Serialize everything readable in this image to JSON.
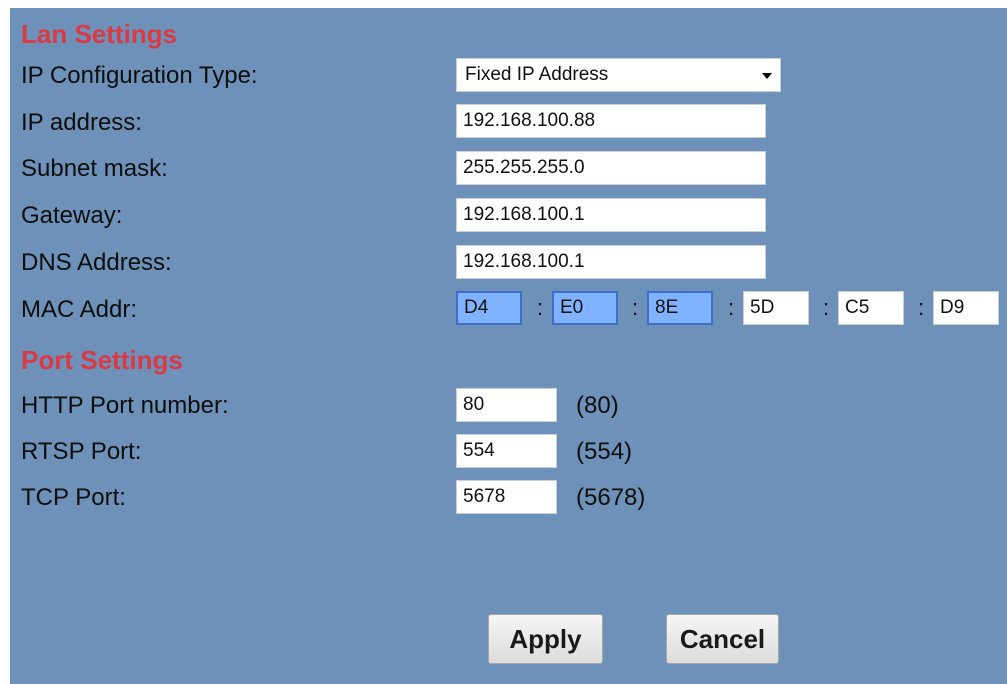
{
  "lan": {
    "title": "Lan Settings",
    "ip_config_label": "IP Configuration Type:",
    "ip_config_value": "Fixed IP Address",
    "ip_address_label": "IP address:",
    "ip_address": "192.168.100.88",
    "subnet_label": "Subnet mask:",
    "subnet": "255.255.255.0",
    "gateway_label": "Gateway:",
    "gateway": "192.168.100.1",
    "dns_label": "DNS Address:",
    "dns": "192.168.100.1",
    "mac_label": "MAC Addr:",
    "mac": [
      "D4",
      "E0",
      "8E",
      "5D",
      "C5",
      "D9"
    ],
    "mac_separator": ":"
  },
  "port": {
    "title": "Port Settings",
    "http_label": "HTTP Port number:",
    "http_value": "80",
    "http_default": "(80)",
    "rtsp_label": "RTSP Port:",
    "rtsp_value": "554",
    "rtsp_default": "(554)",
    "tcp_label": "TCP Port:",
    "tcp_value": "5678",
    "tcp_default": "(5678)"
  },
  "buttons": {
    "apply": "Apply",
    "cancel": "Cancel"
  },
  "colors": {
    "panel_bg": "#6d91b9",
    "section_title": "#d93a43",
    "mac_selected": "#7fb2ff"
  }
}
